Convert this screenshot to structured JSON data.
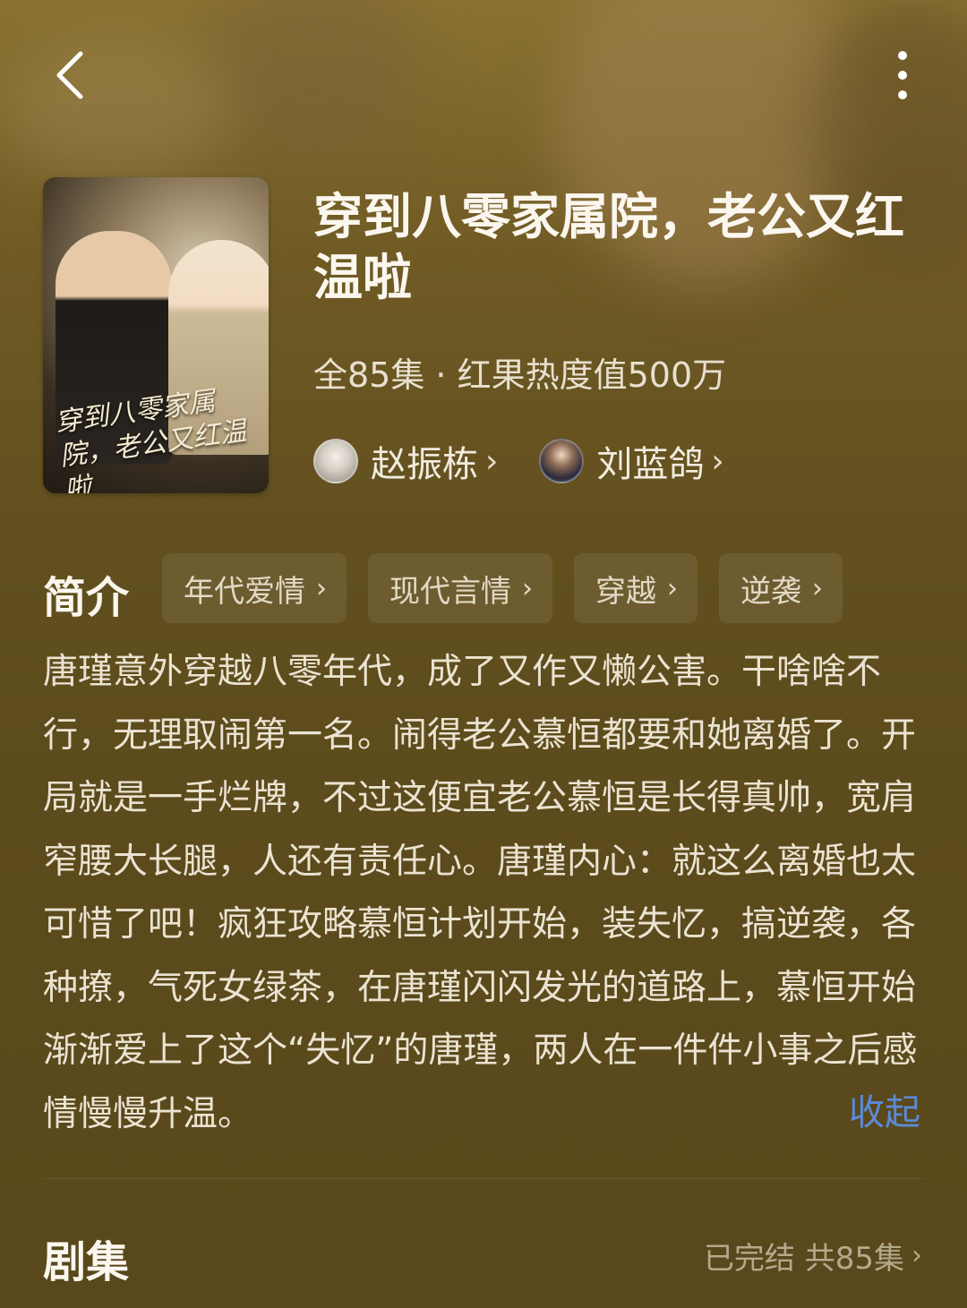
{
  "show": {
    "title": "穿到八零家属院，老公又红温啦",
    "meta": "全85集 · 红果热度值500万",
    "poster_title": "穿到八零家属院，老公又红温啦"
  },
  "cast": [
    {
      "name": "赵振栋"
    },
    {
      "name": "刘蓝鸽"
    }
  ],
  "intro": {
    "label": "简介",
    "tags": [
      "年代爱情",
      "现代言情",
      "穿越",
      "逆袭"
    ],
    "text": "唐瑾意外穿越八零年代，成了又作又懒公害。干啥啥不行，无理取闹第一名。闹得老公慕恒都要和她离婚了。开局就是一手烂牌，不过这便宜老公慕恒是长得真帅，宽肩窄腰大长腿，人还有责任心。唐瑾内心：就这么离婚也太可惜了吧！疯狂攻略慕恒计划开始，装失忆，搞逆袭，各种撩，气死女绿茶，在唐瑾闪闪发光的道路上，慕恒开始渐渐爱上了这个“失忆”的唐瑾，两人在一件件小事之后感情慢慢升温。",
    "collapse_label": "收起"
  },
  "episodes": {
    "label": "剧集",
    "status": "已完结 共85集"
  },
  "icons": {
    "back": "chevron-left-icon",
    "more": "more-vertical-icon",
    "arrow": "chevron-right-icon"
  },
  "colors": {
    "background": "#62501f",
    "link": "#5b8ad8"
  }
}
